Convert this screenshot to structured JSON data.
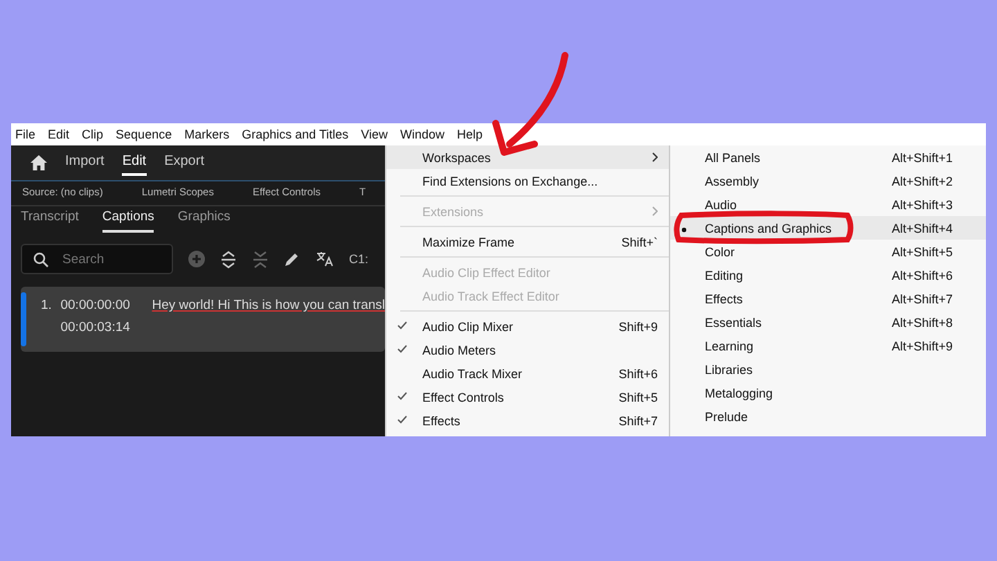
{
  "menu_bar": [
    "File",
    "Edit",
    "Clip",
    "Sequence",
    "Markers",
    "Graphics and Titles",
    "View",
    "Window",
    "Help"
  ],
  "header": {
    "tabs": [
      {
        "label": "Import",
        "selected": false
      },
      {
        "label": "Edit",
        "selected": true
      },
      {
        "label": "Export",
        "selected": false
      }
    ]
  },
  "panel_tabs": [
    "Source: (no clips)",
    "Lumetri Scopes",
    "Effect Controls",
    "T"
  ],
  "caption_tabs": [
    {
      "label": "Transcript",
      "selected": false
    },
    {
      "label": "Captions",
      "selected": true
    },
    {
      "label": "Graphics",
      "selected": false
    }
  ],
  "search": {
    "placeholder": "Search"
  },
  "toolbar_text": "C1:",
  "captions": [
    {
      "number": "1.",
      "start": "00:00:00:00",
      "end": "00:00:03:14",
      "text": "Hey world! Hi This is how you can transl"
    }
  ],
  "window_menu": [
    {
      "kind": "item",
      "label": "Workspaces",
      "submenu": true,
      "selected": true,
      "disabled": false,
      "checked": false
    },
    {
      "kind": "item",
      "label": "Find Extensions on Exchange...",
      "submenu": false,
      "selected": false,
      "disabled": false,
      "checked": false
    },
    {
      "kind": "separator"
    },
    {
      "kind": "item",
      "label": "Extensions",
      "submenu": true,
      "selected": false,
      "disabled": true,
      "checked": false
    },
    {
      "kind": "separator"
    },
    {
      "kind": "item",
      "label": "Maximize Frame",
      "shortcut": "Shift+`",
      "submenu": false,
      "selected": false,
      "disabled": false,
      "checked": false
    },
    {
      "kind": "separator"
    },
    {
      "kind": "item",
      "label": "Audio Clip Effect Editor",
      "submenu": false,
      "selected": false,
      "disabled": true,
      "checked": false
    },
    {
      "kind": "item",
      "label": "Audio Track Effect Editor",
      "submenu": false,
      "selected": false,
      "disabled": true,
      "checked": false
    },
    {
      "kind": "separator"
    },
    {
      "kind": "item",
      "label": "Audio Clip Mixer",
      "shortcut": "Shift+9",
      "submenu": false,
      "selected": false,
      "disabled": false,
      "checked": true
    },
    {
      "kind": "item",
      "label": "Audio Meters",
      "submenu": false,
      "selected": false,
      "disabled": false,
      "checked": true
    },
    {
      "kind": "item",
      "label": "Audio Track Mixer",
      "shortcut": "Shift+6",
      "submenu": false,
      "selected": false,
      "disabled": false,
      "checked": false
    },
    {
      "kind": "item",
      "label": "Effect Controls",
      "shortcut": "Shift+5",
      "submenu": false,
      "selected": false,
      "disabled": false,
      "checked": true
    },
    {
      "kind": "item",
      "label": "Effects",
      "shortcut": "Shift+7",
      "submenu": false,
      "selected": false,
      "disabled": false,
      "checked": true
    }
  ],
  "workspaces_menu": [
    {
      "label": "All Panels",
      "shortcut": "Alt+Shift+1",
      "selected": false,
      "hovered": false
    },
    {
      "label": "Assembly",
      "shortcut": "Alt+Shift+2",
      "selected": false,
      "hovered": false
    },
    {
      "label": "Audio",
      "shortcut": "Alt+Shift+3",
      "selected": false,
      "hovered": false
    },
    {
      "label": "Captions and Graphics",
      "shortcut": "Alt+Shift+4",
      "selected": true,
      "hovered": true
    },
    {
      "label": "Color",
      "shortcut": "Alt+Shift+5",
      "selected": false,
      "hovered": false
    },
    {
      "label": "Editing",
      "shortcut": "Alt+Shift+6",
      "selected": false,
      "hovered": false
    },
    {
      "label": "Effects",
      "shortcut": "Alt+Shift+7",
      "selected": false,
      "hovered": false
    },
    {
      "label": "Essentials",
      "shortcut": "Alt+Shift+8",
      "selected": false,
      "hovered": false
    },
    {
      "label": "Learning",
      "shortcut": "Alt+Shift+9",
      "selected": false,
      "hovered": false
    },
    {
      "label": "Libraries",
      "selected": false,
      "hovered": false
    },
    {
      "label": "Metalogging",
      "selected": false,
      "hovered": false
    },
    {
      "label": "Prelude",
      "selected": false,
      "hovered": false
    }
  ]
}
